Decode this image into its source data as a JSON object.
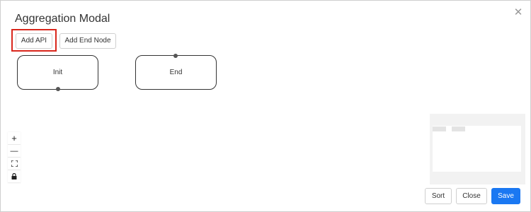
{
  "modal": {
    "title": "Aggregation Modal",
    "close_icon": "close-icon"
  },
  "toolbar": {
    "add_api_label": "Add API",
    "add_end_node_label": "Add End Node",
    "highlight_color": "#d9261c"
  },
  "canvas": {
    "nodes": [
      {
        "label": "Init"
      },
      {
        "label": "End"
      }
    ]
  },
  "controls": {
    "zoom_in": "+",
    "zoom_out": "—",
    "fit_view_icon": "fit-view-icon",
    "lock_icon": "lock-icon"
  },
  "footer": {
    "sort_label": "Sort",
    "close_label": "Close",
    "save_label": "Save",
    "primary_color": "#1a78f2"
  }
}
